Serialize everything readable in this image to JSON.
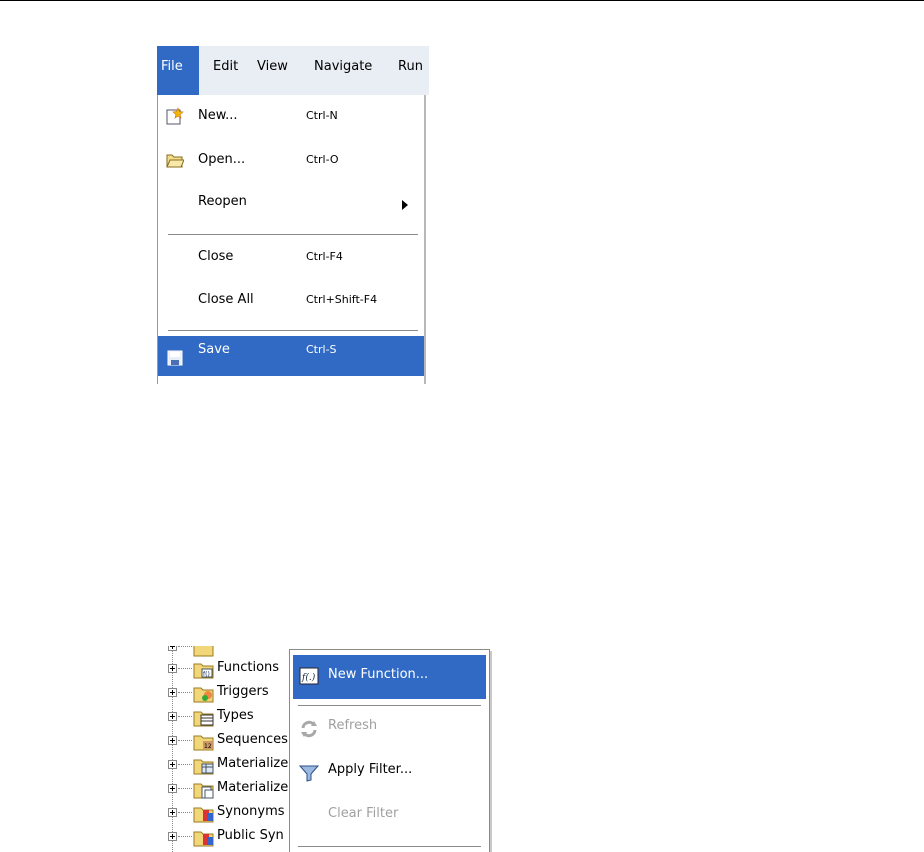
{
  "menubar": {
    "items": [
      {
        "label": "File"
      },
      {
        "label": "Edit"
      },
      {
        "label": "View"
      },
      {
        "label": "Navigate"
      },
      {
        "label": "Run"
      }
    ]
  },
  "file_menu": {
    "items": [
      {
        "label": "New...",
        "shortcut": "Ctrl-N",
        "icon": "new-file-icon"
      },
      {
        "label": "Open...",
        "shortcut": "Ctrl-O",
        "icon": "folder-open-icon"
      },
      {
        "label": "Reopen",
        "shortcut": "",
        "submenu": true
      },
      {
        "label": "Close",
        "shortcut": "Ctrl-F4"
      },
      {
        "label": "Close All",
        "shortcut": "Ctrl+Shift-F4"
      },
      {
        "label": "Save",
        "shortcut": "Ctrl-S",
        "icon": "save-disk-icon",
        "selected": true
      }
    ]
  },
  "tree": {
    "items": [
      {
        "label": "Functions"
      },
      {
        "label": "Triggers"
      },
      {
        "label": "Types"
      },
      {
        "label": "Sequences"
      },
      {
        "label": "Materialized"
      },
      {
        "label": "Materialized"
      },
      {
        "label": "Synonyms"
      },
      {
        "label": "Public Syn"
      }
    ]
  },
  "context_menu": {
    "items": [
      {
        "label": "New Function...",
        "selected": true,
        "icon": "function-icon"
      },
      {
        "label": "Refresh",
        "disabled": true,
        "icon": "refresh-icon"
      },
      {
        "label": "Apply Filter...",
        "icon": "filter-funnel-icon"
      },
      {
        "label": "Clear Filter",
        "disabled": true
      }
    ]
  },
  "colors": {
    "selection": "#316ac5",
    "menubar_bg": "#e9eef4",
    "disabled_text": "#a0a0a0"
  }
}
